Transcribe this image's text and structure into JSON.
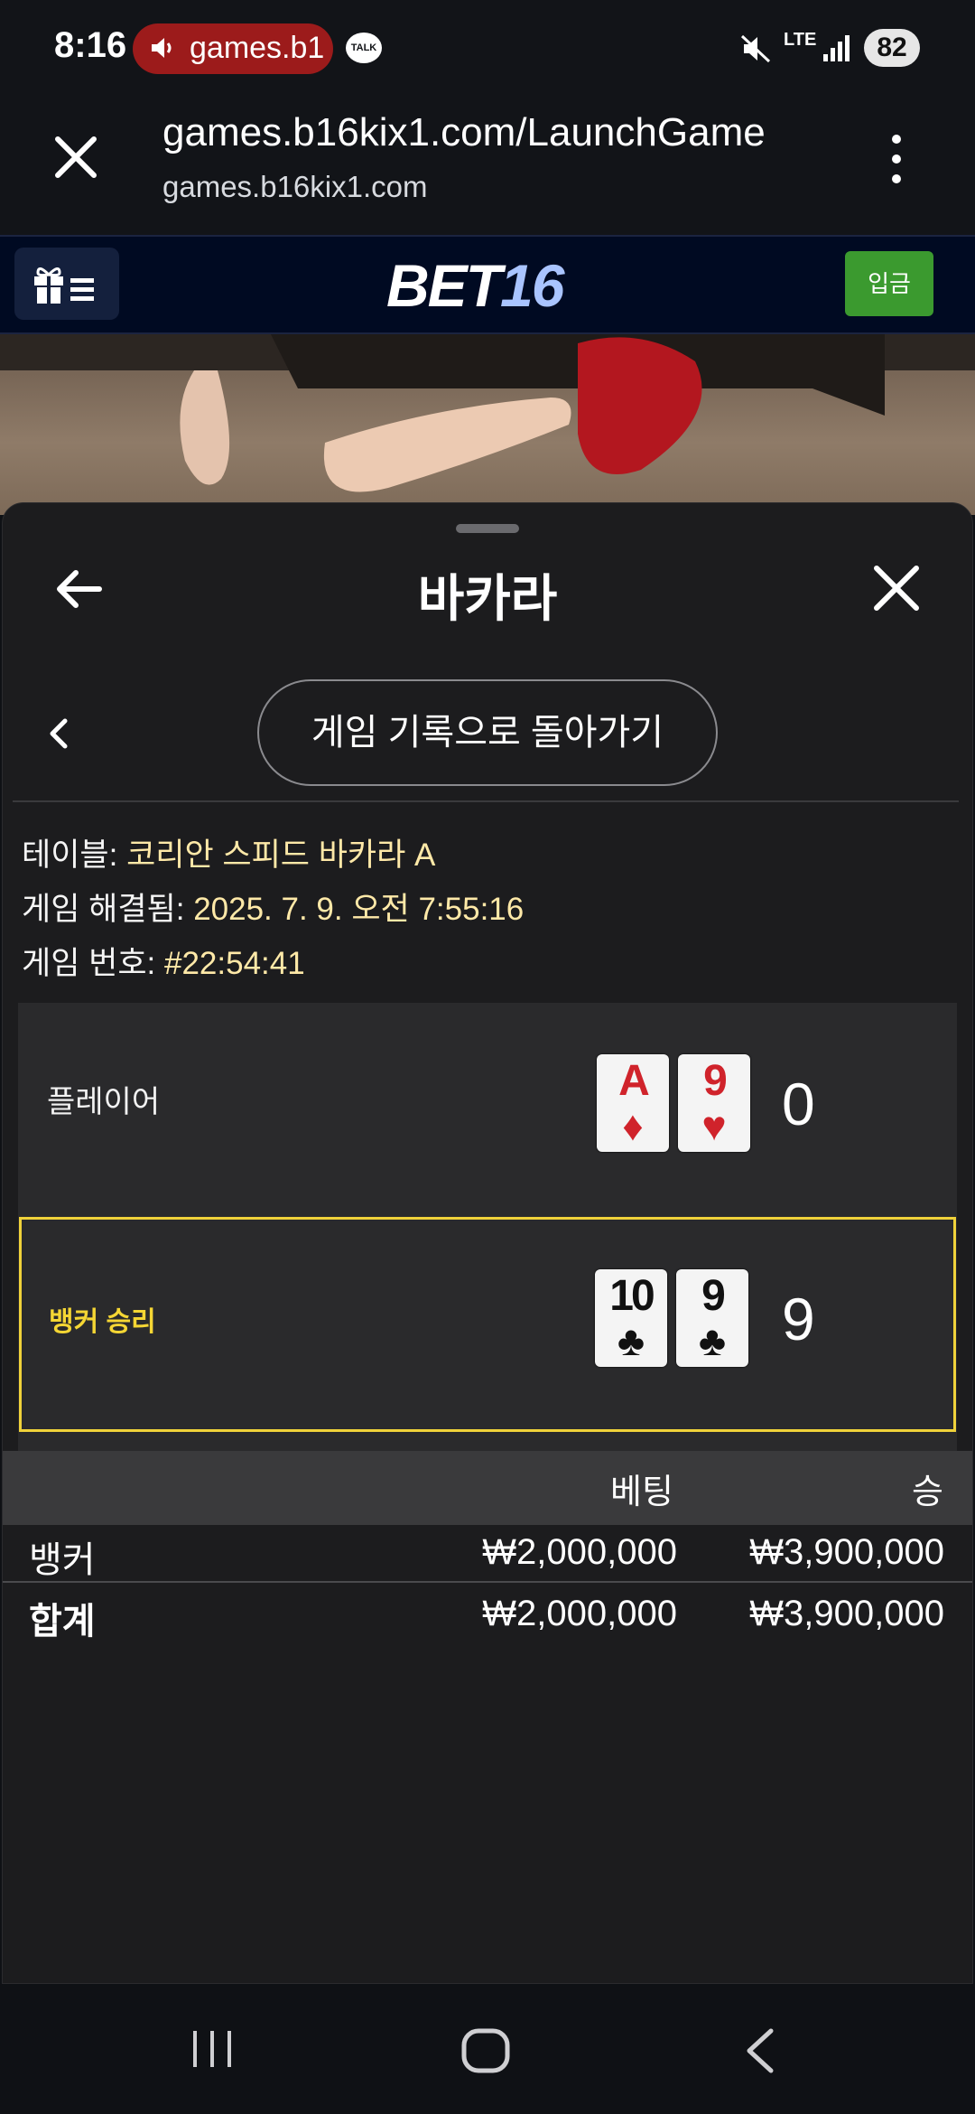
{
  "status_bar": {
    "time": "8:16",
    "media_label": "games.b1",
    "talk_badge": "TALK",
    "network": "LTE",
    "battery": "82"
  },
  "browser": {
    "url_path": "games.b16kix1.com/LaunchGame",
    "url_host": "games.b16kix1.com"
  },
  "site_header": {
    "logo_part1": "BET",
    "logo_part2": "16",
    "deposit_label": "입금",
    "accent_color": "#3b9a2f",
    "logo_accent_color": "#a9c4ff"
  },
  "sheet": {
    "title": "바카라",
    "history_button": "게임 기록으로 돌아가기",
    "info": {
      "table_label": "테이블: ",
      "table_value": "코리안 스피드 바카라 A",
      "resolved_label": "게임 해결됨: ",
      "resolved_value": "2025. 7. 9. 오전 7:55:16",
      "number_label": "게임 번호: ",
      "number_value": "#22:54:41"
    },
    "player": {
      "label": "플레이어",
      "cards": [
        {
          "rank": "A",
          "suit": "♦"
        },
        {
          "rank": "9",
          "suit": "♥"
        }
      ],
      "score": "0"
    },
    "banker": {
      "label": "뱅커 승리",
      "cards": [
        {
          "rank": "10",
          "suit": "♣"
        },
        {
          "rank": "9",
          "suit": "♣"
        }
      ],
      "score": "9",
      "highlight_color": "#f0d23a"
    },
    "bets": {
      "col_bet": "베팅",
      "col_win": "승",
      "rows": [
        {
          "label": "뱅커",
          "bet": "₩2,000,000",
          "win": "₩3,900,000"
        },
        {
          "label": "합계",
          "bet": "₩2,000,000",
          "win": "₩3,900,000"
        }
      ]
    }
  }
}
